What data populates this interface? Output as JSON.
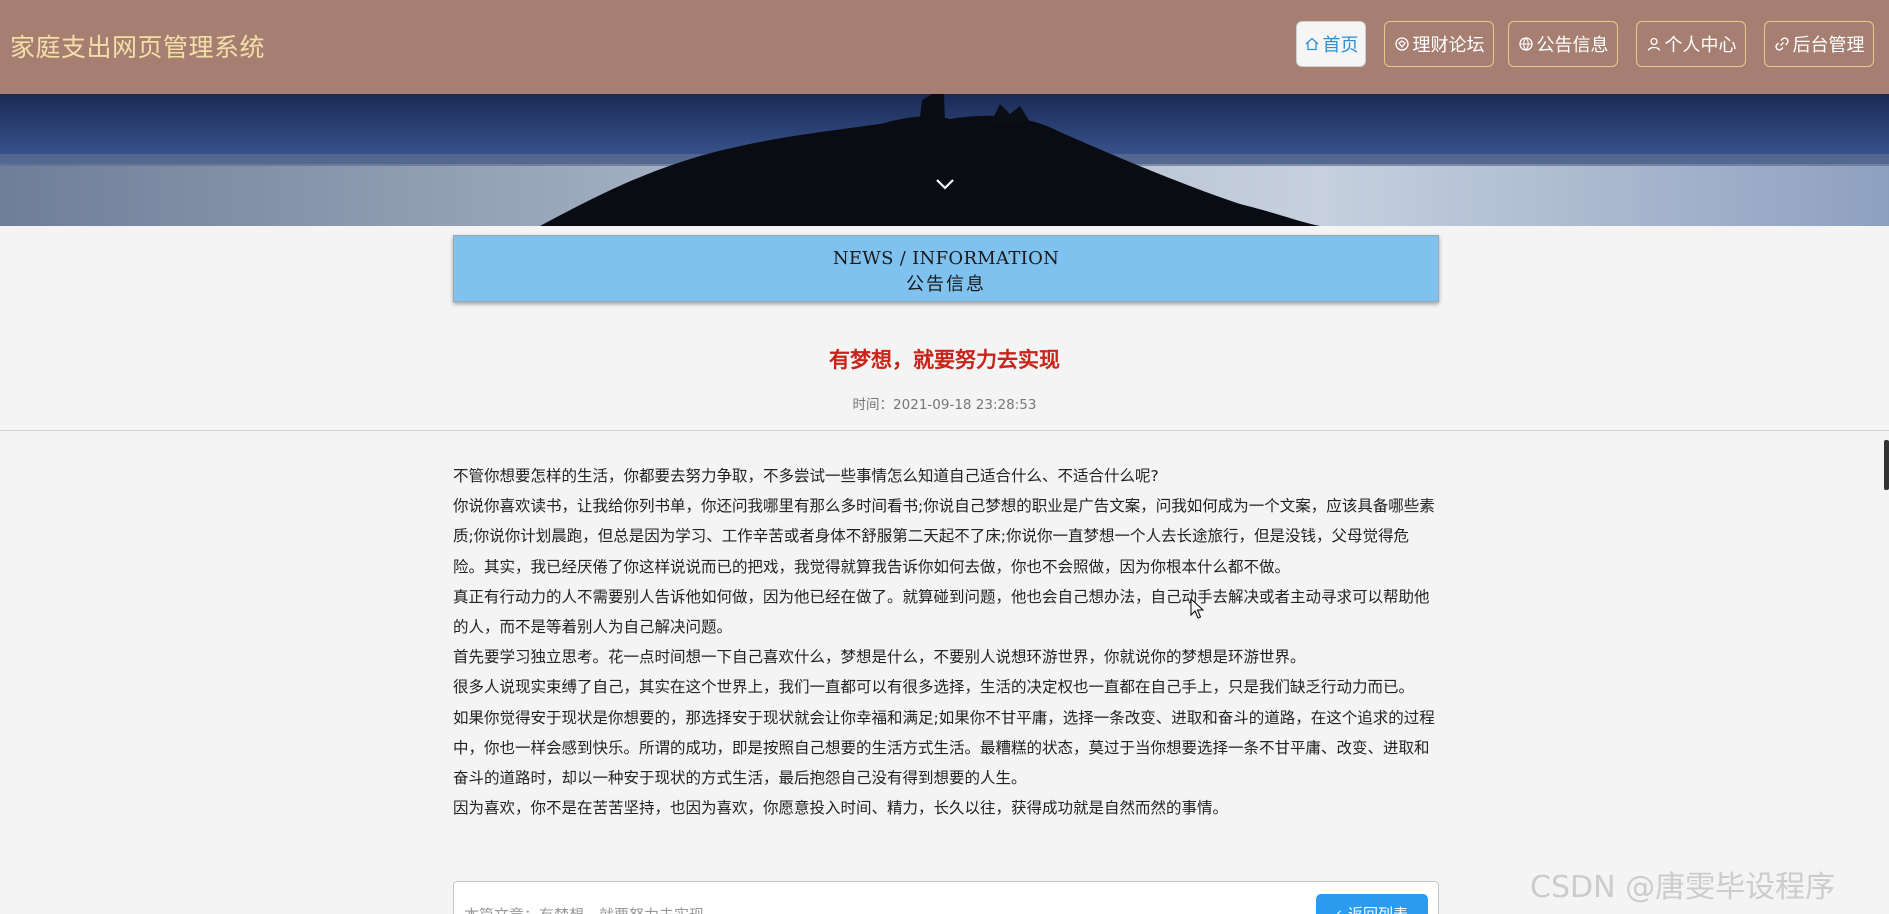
{
  "header": {
    "site_title": "家庭支出网页管理系统",
    "nav": [
      {
        "label": "首页",
        "icon": "home-icon",
        "active": true
      },
      {
        "label": "理财论坛",
        "icon": "forum-icon",
        "active": false
      },
      {
        "label": "公告信息",
        "icon": "globe-icon",
        "active": false
      },
      {
        "label": "个人中心",
        "icon": "user-icon",
        "active": false
      },
      {
        "label": "后台管理",
        "icon": "link-icon",
        "active": false
      }
    ]
  },
  "banner": {
    "scroll_icon": "chevron-down-icon"
  },
  "section": {
    "title_en": "NEWS / INFORMATION",
    "title_cn": "公告信息"
  },
  "article": {
    "title": "有梦想，就要努力去实现",
    "time": "时间：2021-09-18 23:28:53",
    "paragraphs": [
      "不管你想要怎样的生活，你都要去努力争取，不多尝试一些事情怎么知道自己适合什么、不适合什么呢?",
      "你说你喜欢读书，让我给你列书单，你还问我哪里有那么多时间看书;你说自己梦想的职业是广告文案，问我如何成为一个文案，应该具备哪些素质;你说你计划晨跑，但总是因为学习、工作辛苦或者身体不舒服第二天起不了床;你说你一直梦想一个人去长途旅行，但是没钱，父母觉得危险。其实，我已经厌倦了你这样说说而已的把戏，我觉得就算我告诉你如何去做，你也不会照做，因为你根本什么都不做。",
      "真正有行动力的人不需要别人告诉他如何做，因为他已经在做了。就算碰到问题，他也会自己想办法，自己动手去解决或者主动寻求可以帮助他的人，而不是等着别人为自己解决问题。",
      "首先要学习独立思考。花一点时间想一下自己喜欢什么，梦想是什么，不要别人说想环游世界，你就说你的梦想是环游世界。",
      "很多人说现实束缚了自己，其实在这个世界上，我们一直都可以有很多选择，生活的决定权也一直都在自己手上，只是我们缺乏行动力而已。",
      "如果你觉得安于现状是你想要的，那选择安于现状就会让你幸福和满足;如果你不甘平庸，选择一条改变、进取和奋斗的道路，在这个追求的过程中，你也一样会感到快乐。所谓的成功，即是按照自己想要的生活方式生活。最糟糕的状态，莫过于当你想要选择一条不甘平庸、改变、进取和奋斗的道路时，却以一种安于现状的方式生活，最后抱怨自己没有得到想要的人生。",
      "因为喜欢，你不是在苦苦坚持，也因为喜欢，你愿意投入时间、精力，长久以往，获得成功就是自然而然的事情。"
    ]
  },
  "footer_nav": {
    "prev_article": "本篇文章：有梦想，就要努力去实现",
    "back_label": "返回列表"
  },
  "watermark": "CSDN @唐雯毕设程序"
}
